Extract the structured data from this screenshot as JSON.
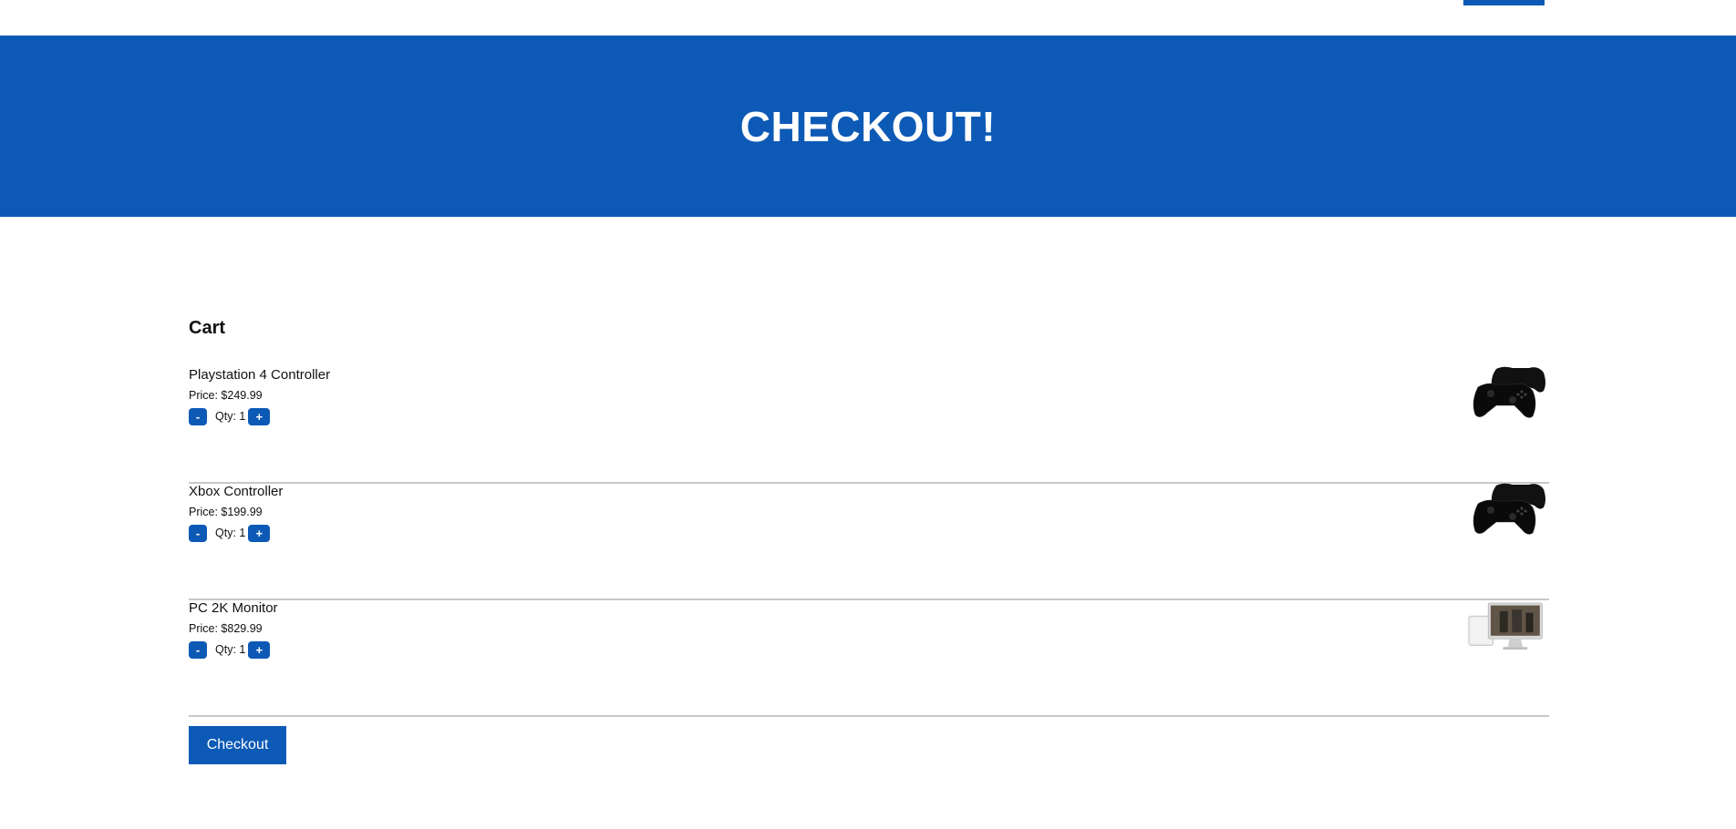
{
  "hero": {
    "title": "CHECKOUT!"
  },
  "cart": {
    "heading": "Cart",
    "items": [
      {
        "name": "Playstation 4 Controller",
        "price": "Price: $249.99",
        "qty": "Qty: 1",
        "image": "game-controllers-image"
      },
      {
        "name": "Xbox Controller",
        "price": "Price: $199.99",
        "qty": "Qty: 1",
        "image": "game-controllers-image"
      },
      {
        "name": "PC 2K Monitor",
        "price": "Price: $829.99",
        "qty": "Qty: 1",
        "image": "desktop-monitor-image"
      }
    ],
    "decrement_label": "-",
    "increment_label": "+"
  },
  "checkout": {
    "label": "Checkout"
  },
  "colors": {
    "brand": "#0d5ab6",
    "divider": "#c8c8c8",
    "text": "#111111"
  }
}
